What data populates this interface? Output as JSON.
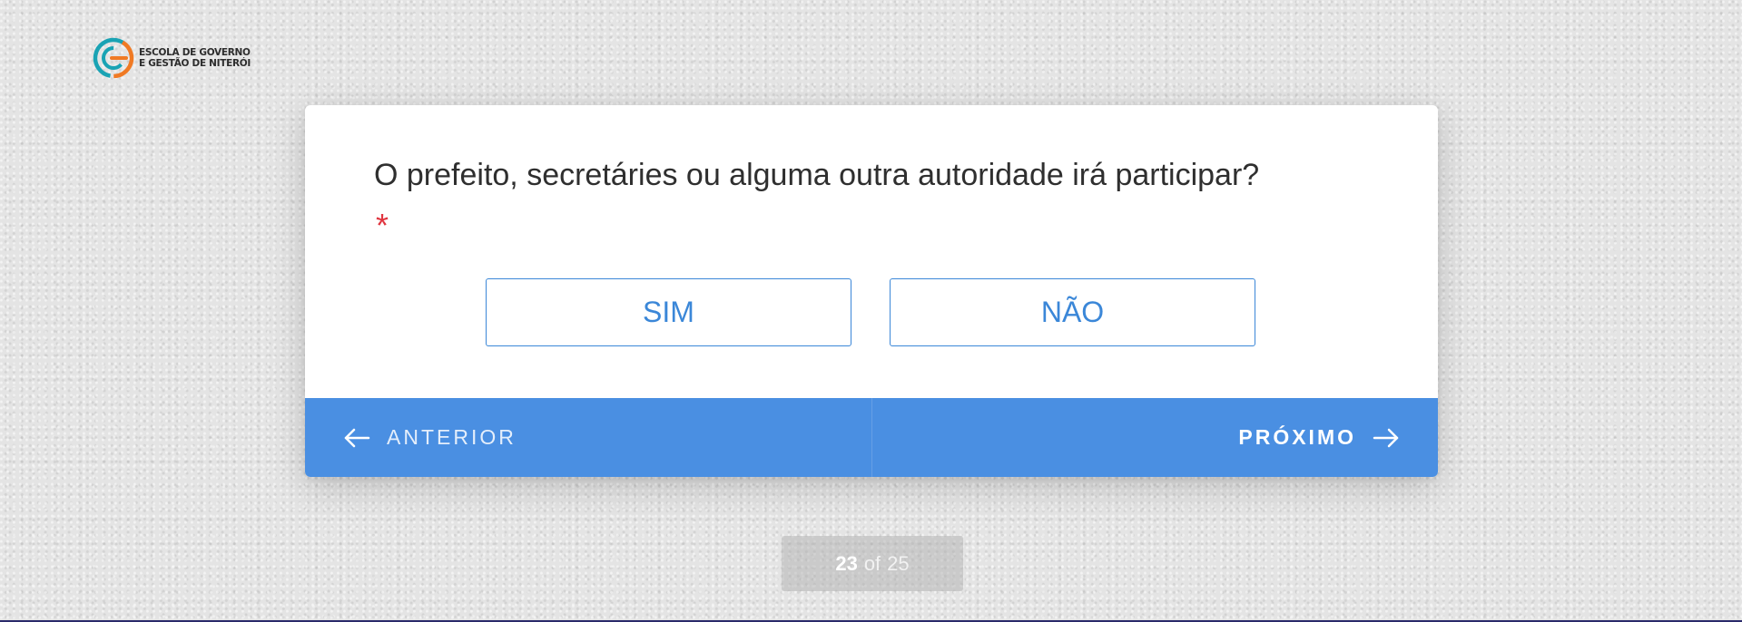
{
  "branding": {
    "logo_line1": "ESCOLA DE GOVERNO",
    "logo_line2": "E GESTÃO DE NITERÓI",
    "logo_icon": "egg-logo-icon",
    "colors": {
      "teal": "#1aa3b4",
      "orange": "#f07a24"
    }
  },
  "question": {
    "text": "O prefeito, secretáries ou alguma outra autoridade irá participar?",
    "required_marker": "*"
  },
  "choices": [
    {
      "label": "SIM"
    },
    {
      "label": "NÃO"
    }
  ],
  "navigation": {
    "prev_label": "ANTERIOR",
    "next_label": "PRÓXIMO",
    "prev_icon": "arrow-left-icon",
    "next_icon": "arrow-right-icon"
  },
  "progress": {
    "current": "23",
    "separator": "of",
    "total": "25"
  },
  "colors": {
    "accent": "#4a8fe2",
    "choice_border": "#3b87d8",
    "required": "#e0353f"
  }
}
